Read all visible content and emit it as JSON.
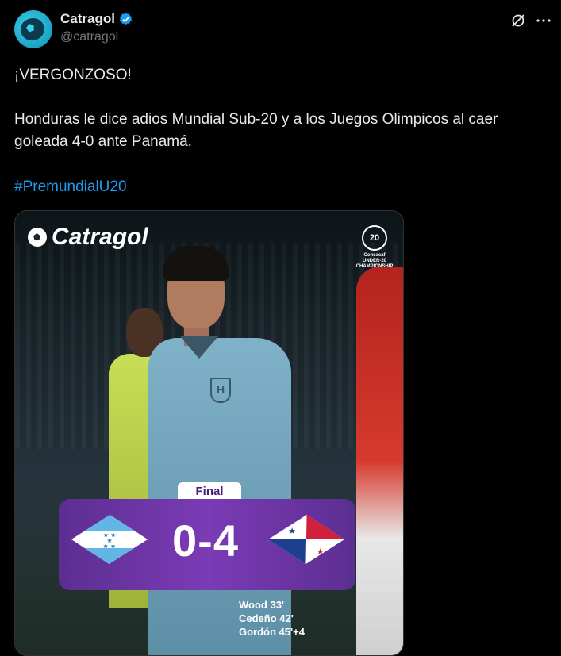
{
  "account": {
    "name": "Catragol",
    "handle": "@catragol"
  },
  "tweet": {
    "line1": "¡VERGONZOSO!",
    "line2": "Honduras le dice adios Mundial Sub-20 y a los Juegos Olimpicos al caer goleada 4-0 ante Panamá.",
    "hashtag": "#PremundialU20"
  },
  "media": {
    "brand": "Catragol",
    "championship_badge": "20",
    "championship_text": "Concacaf UNDER-20 CHAMPIONSHIP",
    "final_label": "Final",
    "score": "0-4",
    "home_flag": "honduras-flag",
    "away_flag": "panama-flag",
    "scorers": [
      "Wood 33'",
      "Cedeño 42'",
      "Gordón 45'+4"
    ]
  },
  "colors": {
    "link": "#1d9bf0",
    "verified": "#1d9bf0",
    "panel": "#6a34a3"
  }
}
